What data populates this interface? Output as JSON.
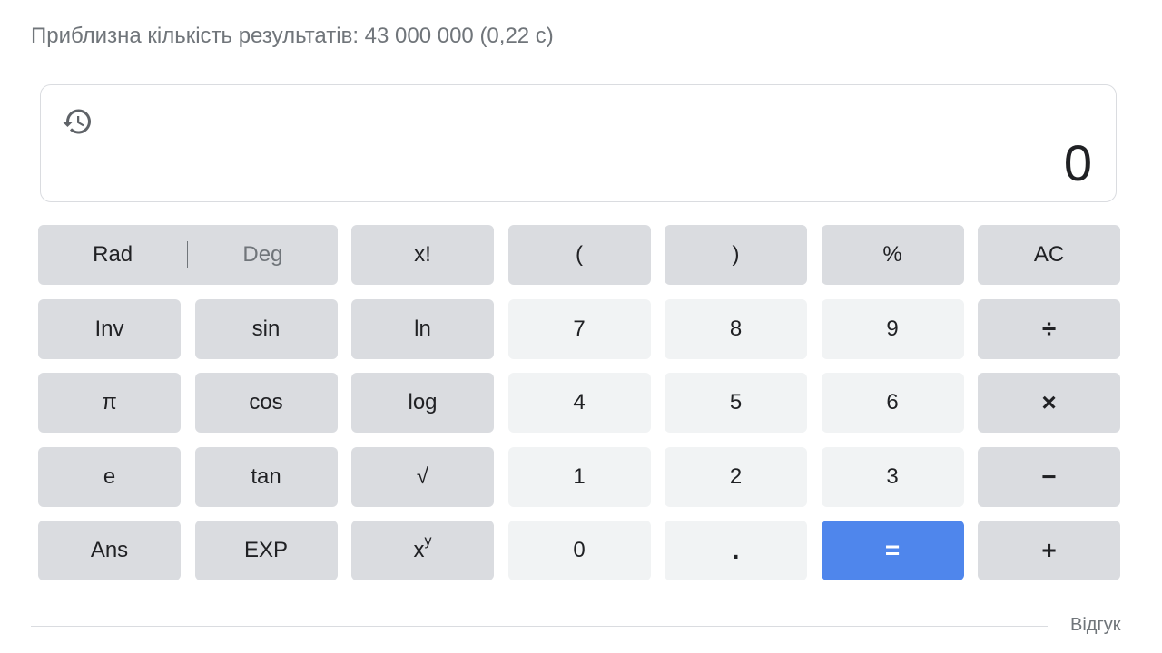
{
  "result_stats": "Приблизна кількість результатів: 43 000 000 (0,22 с)",
  "display": {
    "value": "0",
    "history_icon": "history-icon"
  },
  "mode": {
    "rad_label": "Rad",
    "deg_label": "Deg",
    "active": "Rad"
  },
  "keys": {
    "factorial": "x!",
    "open_paren": "(",
    "close_paren": ")",
    "percent": "%",
    "clear": "AC",
    "inv": "Inv",
    "sin": "sin",
    "ln": "ln",
    "seven": "7",
    "eight": "8",
    "nine": "9",
    "divide": "÷",
    "pi": "π",
    "cos": "cos",
    "log": "log",
    "four": "4",
    "five": "5",
    "six": "6",
    "multiply": "×",
    "e": "e",
    "tan": "tan",
    "sqrt": "√",
    "one": "1",
    "two": "2",
    "three": "3",
    "minus": "−",
    "ans": "Ans",
    "exp": "EXP",
    "power_base": "x",
    "power_exp": "y",
    "zero": "0",
    "dot": ".",
    "equals": "=",
    "plus": "+"
  },
  "footer": {
    "feedback": "Відгук"
  },
  "colors": {
    "key_dark": "#dadce0",
    "key_light": "#f1f3f4",
    "equals": "#4f86ec",
    "muted_text": "#70757a"
  }
}
